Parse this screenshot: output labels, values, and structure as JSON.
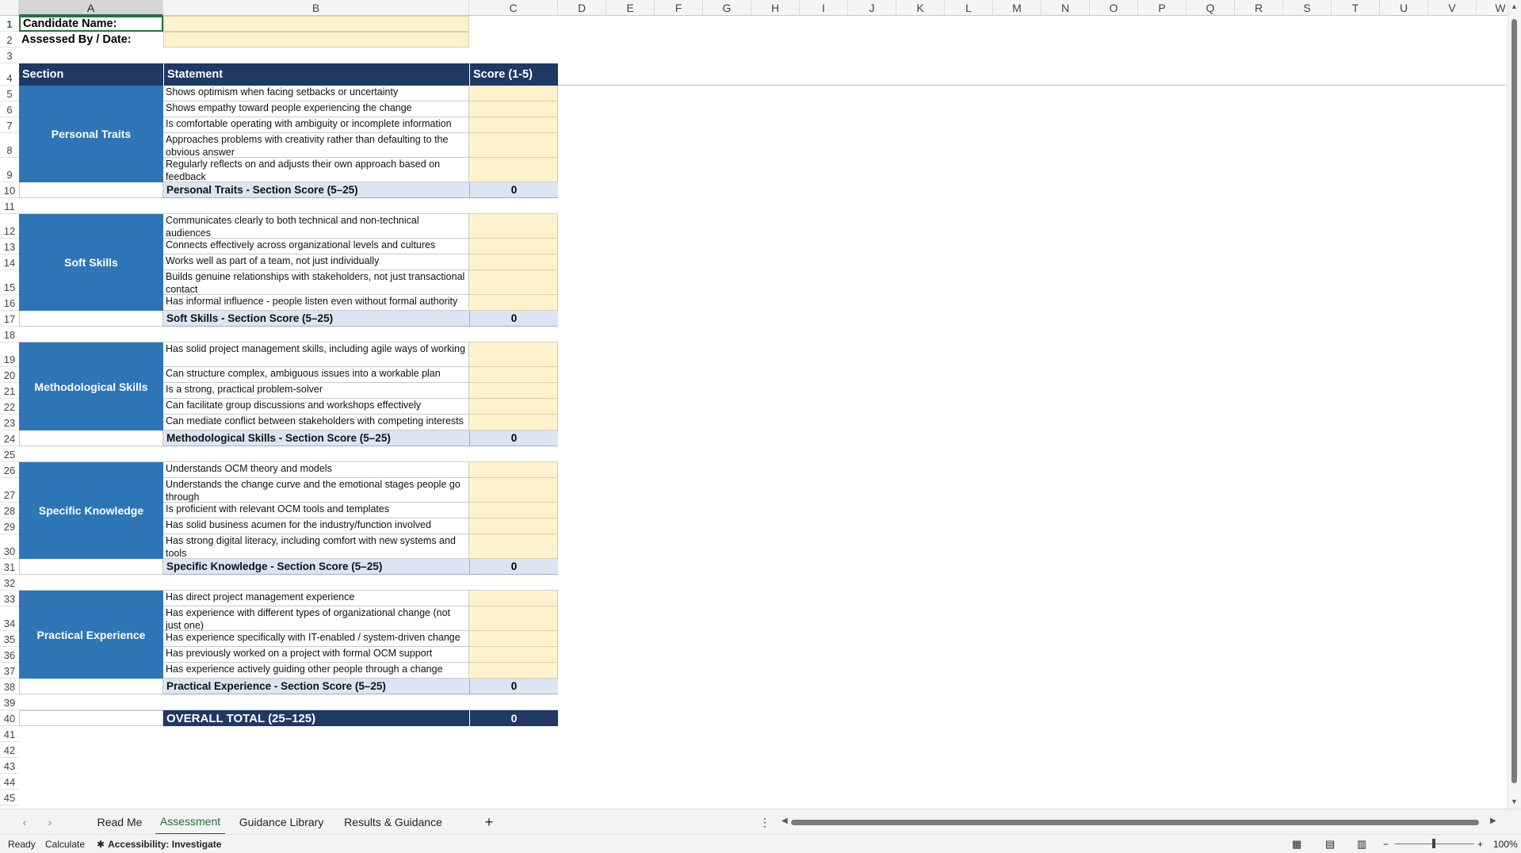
{
  "columns": [
    "A",
    "B",
    "C",
    "D",
    "E",
    "F",
    "G",
    "H",
    "I",
    "J",
    "K",
    "L",
    "M",
    "N",
    "O",
    "P",
    "Q",
    "R",
    "S",
    "T",
    "U",
    "V",
    "W"
  ],
  "rows": [
    "1",
    "2",
    "3",
    "4",
    "5",
    "6",
    "7",
    "8",
    "9",
    "10",
    "11",
    "12",
    "13",
    "14",
    "15",
    "16",
    "17",
    "18",
    "19",
    "20",
    "21",
    "22",
    "23",
    "24",
    "25",
    "26",
    "27",
    "28",
    "29",
    "30",
    "31",
    "32",
    "33",
    "34",
    "35",
    "36",
    "37",
    "38",
    "39",
    "40",
    "41",
    "42",
    "43",
    "44",
    "45"
  ],
  "header_fields": {
    "candidate_label": "Candidate Name:",
    "assessed_label": "Assessed By / Date:"
  },
  "table_header": {
    "section": "Section",
    "statement": "Statement",
    "score": "Score (1-5)"
  },
  "sections": [
    {
      "name": "Personal Traits",
      "statements": [
        "Shows optimism when facing setbacks or uncertainty",
        "Shows empathy toward people experiencing the change",
        "Is comfortable operating with ambiguity or incomplete information",
        "Approaches problems with creativity rather than defaulting to the obvious answer",
        "Regularly reflects on and adjusts their own approach based on feedback"
      ],
      "summary_label": "Personal Traits - Section Score (5–25)",
      "summary_value": "0"
    },
    {
      "name": "Soft Skills",
      "statements": [
        "Communicates clearly to both technical and non-technical audiences",
        "Connects effectively across organizational levels and cultures",
        "Works well as part of a team, not just individually",
        "Builds genuine relationships with stakeholders, not just transactional contact",
        "Has informal influence - people listen even without formal authority"
      ],
      "summary_label": "Soft Skills - Section Score (5–25)",
      "summary_value": "0"
    },
    {
      "name": "Methodological Skills",
      "statements": [
        "Has solid project management skills, including agile ways of working",
        "Can structure complex, ambiguous issues into a workable plan",
        "Is a strong, practical problem-solver",
        "Can facilitate group discussions and workshops effectively",
        "Can mediate conflict between stakeholders with competing interests"
      ],
      "summary_label": "Methodological Skills - Section Score (5–25)",
      "summary_value": "0"
    },
    {
      "name": "Specific Knowledge",
      "statements": [
        "Understands OCM theory and models",
        "Understands the change curve and the emotional stages people go through",
        "Is proficient with relevant OCM tools and templates",
        "Has solid business acumen for the industry/function involved",
        "Has strong digital literacy, including comfort with new systems and tools"
      ],
      "summary_label": "Specific Knowledge - Section Score (5–25)",
      "summary_value": "0"
    },
    {
      "name": "Practical Experience",
      "statements": [
        "Has direct project management experience",
        "Has experience with different types of organizational change (not just one)",
        "Has experience specifically with IT-enabled / system-driven change",
        "Has previously worked on a project with formal OCM support",
        "Has experience actively guiding other people through a change"
      ],
      "summary_label": "Practical Experience - Section Score (5–25)",
      "summary_value": "0"
    }
  ],
  "overall": {
    "label": "OVERALL TOTAL (25–125)",
    "value": "0"
  },
  "sheet_tabs": [
    "Read Me",
    "Assessment",
    "Guidance Library",
    "Results & Guidance"
  ],
  "active_tab": "Assessment",
  "add_sheet": "+",
  "status": {
    "ready": "Ready",
    "calculate": "Calculate",
    "accessibility": "Accessibility: Investigate",
    "zoom": "100%"
  },
  "colors": {
    "section_blue": "#2e75b6",
    "header_navy": "#1f3864",
    "score_input": "#fff2cc",
    "summary_fill": "#dbe5f4",
    "accent_green": "#217346"
  }
}
